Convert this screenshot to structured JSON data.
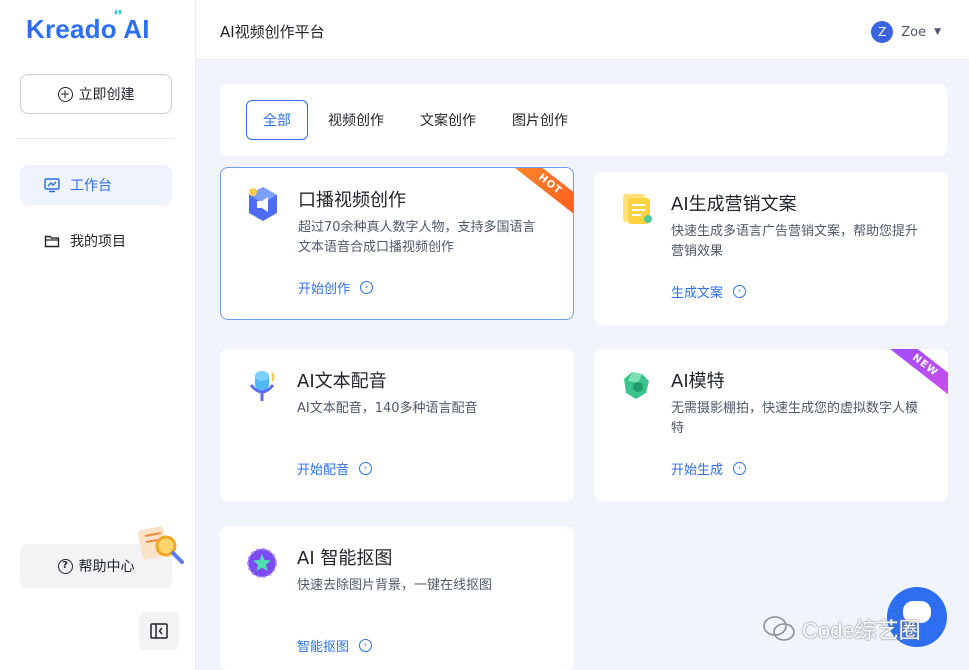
{
  "brand": {
    "logo_text": "Kreado AI"
  },
  "sidebar": {
    "create_label": "立即创建",
    "items": [
      {
        "label": "工作台",
        "icon": "monitor-chart-icon",
        "active": true
      },
      {
        "label": "我的项目",
        "icon": "folder-icon",
        "active": false
      }
    ],
    "help_label": "帮助中心"
  },
  "header": {
    "title": "AI视频创作平台",
    "user": {
      "initial": "Z",
      "name": "Zoe"
    }
  },
  "tabs": [
    {
      "label": "全部",
      "active": true
    },
    {
      "label": "视频创作",
      "active": false
    },
    {
      "label": "文案创作",
      "active": false
    },
    {
      "label": "图片创作",
      "active": false
    }
  ],
  "cards": [
    {
      "title": "口播视频创作",
      "desc": "超过70余种真人数字人物，支持多国语言文本语音合成口播视频创作",
      "link": "开始创作",
      "badge": "HOT",
      "icon": "video-speaker-icon"
    },
    {
      "title": "AI生成营销文案",
      "desc": "快速生成多语言广告营销文案，帮助您提升营销效果",
      "link": "生成文案",
      "badge": "",
      "icon": "document-icon"
    },
    {
      "title": "AI文本配音",
      "desc": "AI文本配音，140多种语言配音",
      "link": "开始配音",
      "badge": "",
      "icon": "microphone-icon"
    },
    {
      "title": "AI模特",
      "desc": "无需摄影棚拍，快速生成您的虚拟数字人模特",
      "link": "开始生成",
      "badge": "NEW",
      "icon": "model-icon"
    },
    {
      "title": "AI 智能抠图",
      "desc": "快速去除图片背景，一键在线抠图",
      "link": "智能抠图",
      "badge": "",
      "icon": "cutout-icon"
    }
  ],
  "watermark": {
    "text": "Code综艺圈"
  },
  "colors": {
    "accent": "#2d6ff0",
    "background": "#f1f4fb",
    "hot": "#ff6a22",
    "new": "#a34cf5"
  }
}
